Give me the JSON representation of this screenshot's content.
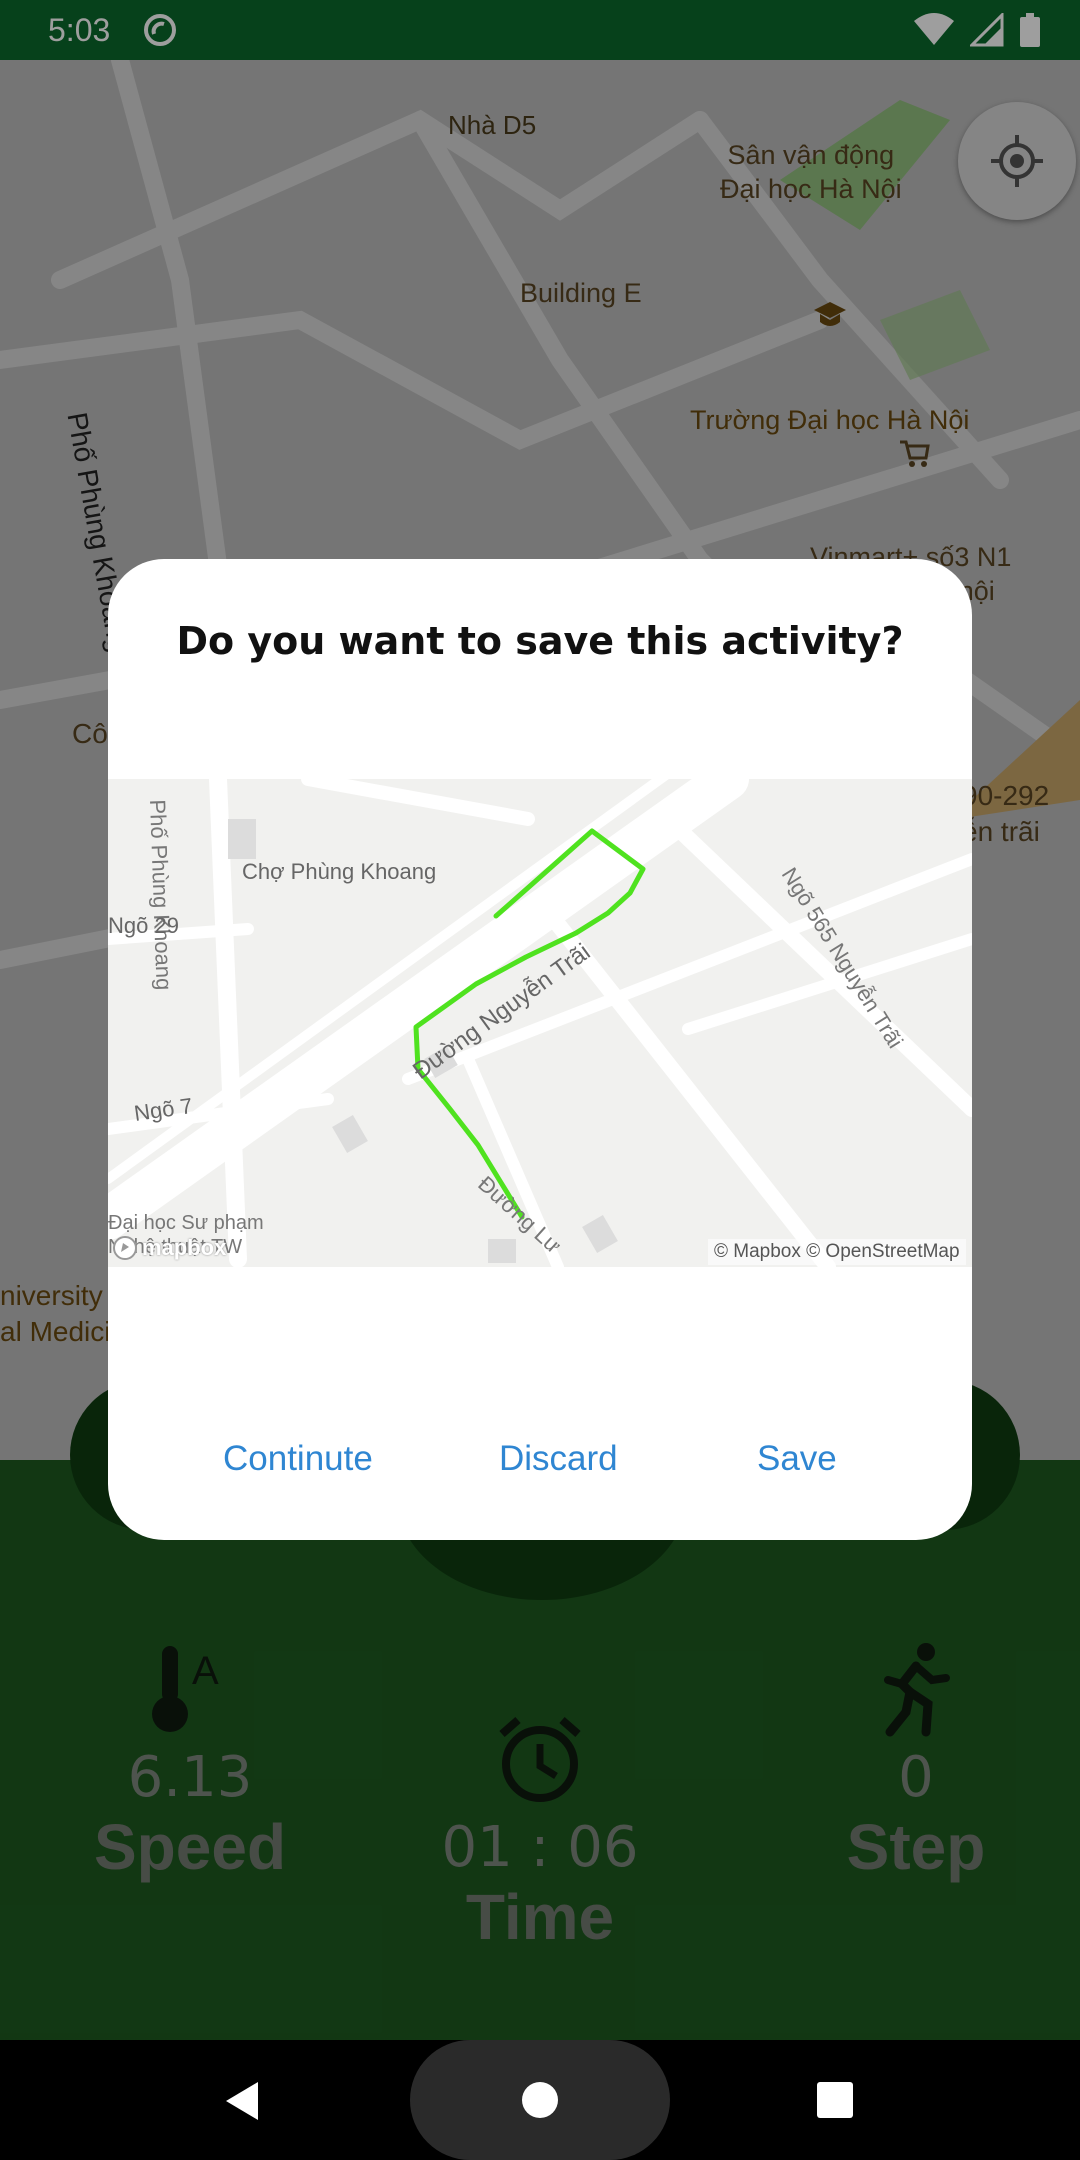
{
  "status_bar": {
    "time": "5:03"
  },
  "map_labels": {
    "nha_d5": "Nhà D5",
    "stadium": "Sân vận động\nĐại học Hà Nội",
    "building_e": "Building E",
    "phung_khoang": "Phố Phùng Khoang",
    "truong": "Trường Đại học Hà Nội",
    "vinmart": "Vinmart+ số3 N1\nđại học hà nội",
    "co": "Cô",
    "addr": "90-292\nễn trãi",
    "university": "niversity\nal Medici"
  },
  "dialog": {
    "title": "Do you want to save this activity?",
    "snapshot": {
      "phung_khoang_street": "Phố Phùng Khoang",
      "cho": "Chợ Phùng Khoang",
      "ngo29": "Ngõ 29",
      "ngo7": "Ngõ 7",
      "nguyen_trai": "Đường Nguyễn Trãi",
      "ngo565": "Ngõ 565 Nguyễn Trãi",
      "duong_lu": "Đường Lư",
      "school": "Đại học Sư phạm\nNghệ thuật TW",
      "mapbox_logo": "mapbox",
      "attribution": "© Mapbox © OpenStreetMap"
    },
    "buttons": {
      "continue": "Continute",
      "discard": "Discard",
      "save": "Save"
    }
  },
  "metrics": {
    "speed": {
      "value": "6.13",
      "label": "Speed"
    },
    "time": {
      "value": "01 : 06",
      "label": "Time"
    },
    "step": {
      "value": "0",
      "label": "Step"
    }
  },
  "colors": {
    "route": "#4fe21f",
    "accent": "#2f86d2",
    "panel": "#1d5a20",
    "status": "#0b6a2c"
  },
  "icons": [
    "dnd-icon",
    "wifi-icon",
    "cellular-icon",
    "battery-icon",
    "my-location-icon",
    "temperature-icon",
    "alarm-clock-icon",
    "running-person-icon",
    "back-icon",
    "home-icon",
    "recents-icon"
  ]
}
